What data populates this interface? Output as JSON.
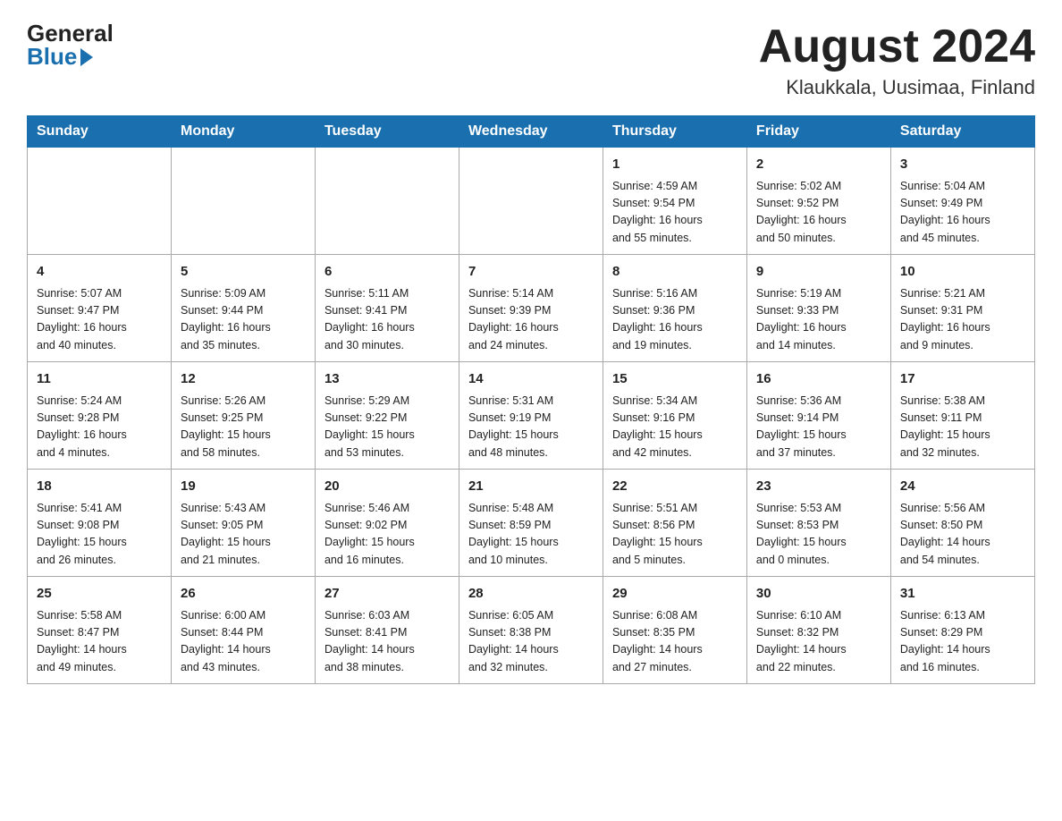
{
  "header": {
    "logo_general": "General",
    "logo_blue": "Blue",
    "month_title": "August 2024",
    "location": "Klaukkala, Uusimaa, Finland"
  },
  "weekdays": [
    "Sunday",
    "Monday",
    "Tuesday",
    "Wednesday",
    "Thursday",
    "Friday",
    "Saturday"
  ],
  "weeks": [
    [
      {
        "day": "",
        "info": ""
      },
      {
        "day": "",
        "info": ""
      },
      {
        "day": "",
        "info": ""
      },
      {
        "day": "",
        "info": ""
      },
      {
        "day": "1",
        "info": "Sunrise: 4:59 AM\nSunset: 9:54 PM\nDaylight: 16 hours\nand 55 minutes."
      },
      {
        "day": "2",
        "info": "Sunrise: 5:02 AM\nSunset: 9:52 PM\nDaylight: 16 hours\nand 50 minutes."
      },
      {
        "day": "3",
        "info": "Sunrise: 5:04 AM\nSunset: 9:49 PM\nDaylight: 16 hours\nand 45 minutes."
      }
    ],
    [
      {
        "day": "4",
        "info": "Sunrise: 5:07 AM\nSunset: 9:47 PM\nDaylight: 16 hours\nand 40 minutes."
      },
      {
        "day": "5",
        "info": "Sunrise: 5:09 AM\nSunset: 9:44 PM\nDaylight: 16 hours\nand 35 minutes."
      },
      {
        "day": "6",
        "info": "Sunrise: 5:11 AM\nSunset: 9:41 PM\nDaylight: 16 hours\nand 30 minutes."
      },
      {
        "day": "7",
        "info": "Sunrise: 5:14 AM\nSunset: 9:39 PM\nDaylight: 16 hours\nand 24 minutes."
      },
      {
        "day": "8",
        "info": "Sunrise: 5:16 AM\nSunset: 9:36 PM\nDaylight: 16 hours\nand 19 minutes."
      },
      {
        "day": "9",
        "info": "Sunrise: 5:19 AM\nSunset: 9:33 PM\nDaylight: 16 hours\nand 14 minutes."
      },
      {
        "day": "10",
        "info": "Sunrise: 5:21 AM\nSunset: 9:31 PM\nDaylight: 16 hours\nand 9 minutes."
      }
    ],
    [
      {
        "day": "11",
        "info": "Sunrise: 5:24 AM\nSunset: 9:28 PM\nDaylight: 16 hours\nand 4 minutes."
      },
      {
        "day": "12",
        "info": "Sunrise: 5:26 AM\nSunset: 9:25 PM\nDaylight: 15 hours\nand 58 minutes."
      },
      {
        "day": "13",
        "info": "Sunrise: 5:29 AM\nSunset: 9:22 PM\nDaylight: 15 hours\nand 53 minutes."
      },
      {
        "day": "14",
        "info": "Sunrise: 5:31 AM\nSunset: 9:19 PM\nDaylight: 15 hours\nand 48 minutes."
      },
      {
        "day": "15",
        "info": "Sunrise: 5:34 AM\nSunset: 9:16 PM\nDaylight: 15 hours\nand 42 minutes."
      },
      {
        "day": "16",
        "info": "Sunrise: 5:36 AM\nSunset: 9:14 PM\nDaylight: 15 hours\nand 37 minutes."
      },
      {
        "day": "17",
        "info": "Sunrise: 5:38 AM\nSunset: 9:11 PM\nDaylight: 15 hours\nand 32 minutes."
      }
    ],
    [
      {
        "day": "18",
        "info": "Sunrise: 5:41 AM\nSunset: 9:08 PM\nDaylight: 15 hours\nand 26 minutes."
      },
      {
        "day": "19",
        "info": "Sunrise: 5:43 AM\nSunset: 9:05 PM\nDaylight: 15 hours\nand 21 minutes."
      },
      {
        "day": "20",
        "info": "Sunrise: 5:46 AM\nSunset: 9:02 PM\nDaylight: 15 hours\nand 16 minutes."
      },
      {
        "day": "21",
        "info": "Sunrise: 5:48 AM\nSunset: 8:59 PM\nDaylight: 15 hours\nand 10 minutes."
      },
      {
        "day": "22",
        "info": "Sunrise: 5:51 AM\nSunset: 8:56 PM\nDaylight: 15 hours\nand 5 minutes."
      },
      {
        "day": "23",
        "info": "Sunrise: 5:53 AM\nSunset: 8:53 PM\nDaylight: 15 hours\nand 0 minutes."
      },
      {
        "day": "24",
        "info": "Sunrise: 5:56 AM\nSunset: 8:50 PM\nDaylight: 14 hours\nand 54 minutes."
      }
    ],
    [
      {
        "day": "25",
        "info": "Sunrise: 5:58 AM\nSunset: 8:47 PM\nDaylight: 14 hours\nand 49 minutes."
      },
      {
        "day": "26",
        "info": "Sunrise: 6:00 AM\nSunset: 8:44 PM\nDaylight: 14 hours\nand 43 minutes."
      },
      {
        "day": "27",
        "info": "Sunrise: 6:03 AM\nSunset: 8:41 PM\nDaylight: 14 hours\nand 38 minutes."
      },
      {
        "day": "28",
        "info": "Sunrise: 6:05 AM\nSunset: 8:38 PM\nDaylight: 14 hours\nand 32 minutes."
      },
      {
        "day": "29",
        "info": "Sunrise: 6:08 AM\nSunset: 8:35 PM\nDaylight: 14 hours\nand 27 minutes."
      },
      {
        "day": "30",
        "info": "Sunrise: 6:10 AM\nSunset: 8:32 PM\nDaylight: 14 hours\nand 22 minutes."
      },
      {
        "day": "31",
        "info": "Sunrise: 6:13 AM\nSunset: 8:29 PM\nDaylight: 14 hours\nand 16 minutes."
      }
    ]
  ]
}
